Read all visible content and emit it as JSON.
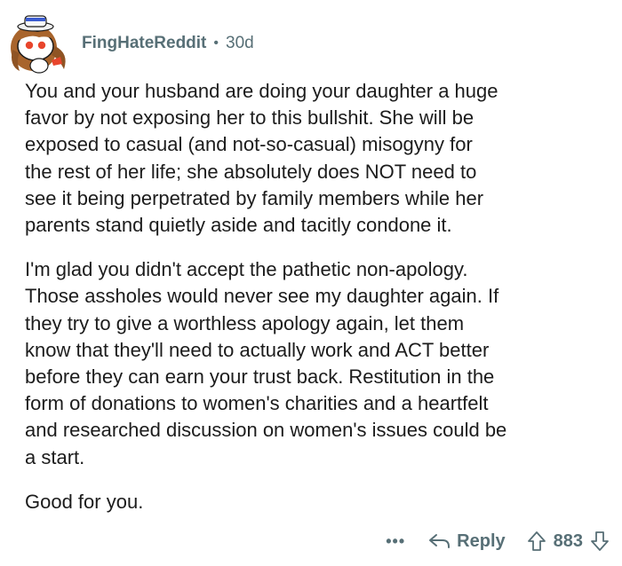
{
  "comment": {
    "username": "FingHateReddit",
    "separator": "•",
    "age": "30d",
    "paragraphs": [
      "You and your husband are doing your daughter a huge\nfavor by not exposing her to this bullshit.  She will be\nexposed to casual (and not-so-casual) misogyny for\nthe rest of her life; she absolutely does NOT need to\nsee it being perpetrated by family members while her\nparents stand quietly aside and tacitly condone it.",
      "I'm glad you didn't accept the pathetic non-apology.\nThose assholes would never see my daughter again.  If\nthey try to give a worthless apology again, let them\nknow that they'll need to actually work and ACT better\nbefore they can earn your trust back.  Restitution in the\nform of donations to women's charities and a heartfelt\nand researched discussion on women's issues could be\na start.",
      "Good for you."
    ]
  },
  "actions": {
    "more_label": "•••",
    "reply_label": "Reply",
    "score": "883"
  },
  "icons": {
    "avatar": "snoo-avatar-icon",
    "reply": "reply-arrow-icon",
    "upvote": "upvote-arrow-icon",
    "downvote": "downvote-arrow-icon"
  },
  "colors": {
    "meta_text": "#576f76",
    "body_text": "#1c1c1c",
    "background": "#ffffff"
  }
}
